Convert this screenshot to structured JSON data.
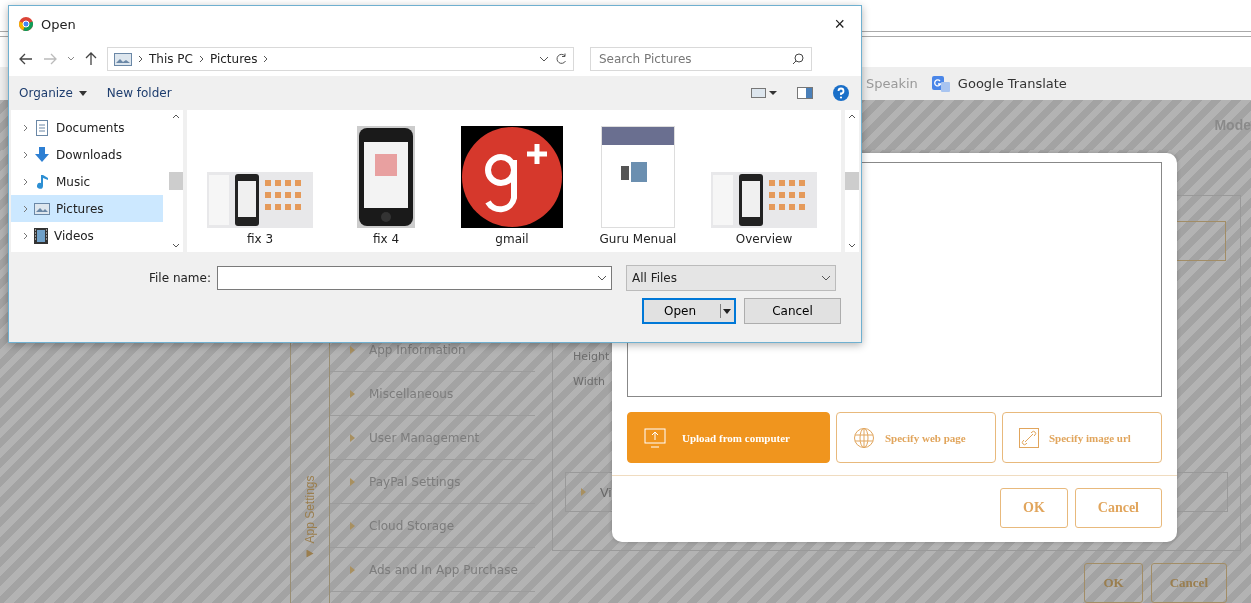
{
  "browser": {
    "bookmarks": [
      {
        "label": "Speakin",
        "kind": "plain"
      },
      {
        "label": "Google Translate",
        "kind": "translate"
      }
    ],
    "header_text": "Mode"
  },
  "app": {
    "side_label": "App Settings",
    "menu": [
      "App Information",
      "Miscellaneous",
      "User Management",
      "PayPal Settings",
      "Cloud Storage",
      "Ads and In App Purchase"
    ],
    "form_labels": [
      "Height",
      "Width"
    ],
    "section": "Vi",
    "buttons": [
      "OK",
      "Cancel"
    ]
  },
  "image_modal": {
    "sources": [
      {
        "label": "Upload from computer",
        "kind": "upload",
        "selected": true
      },
      {
        "label": "Specify web page",
        "kind": "web",
        "selected": false
      },
      {
        "label": "Specify image url",
        "kind": "link",
        "selected": false
      }
    ],
    "buttons": [
      "OK",
      "Cancel"
    ]
  },
  "open_dialog": {
    "title": "Open",
    "close": "×",
    "breadcrumb": [
      "This PC",
      "Pictures"
    ],
    "search": {
      "placeholder": "Search Pictures"
    },
    "toolbar": [
      "Organize",
      "New folder"
    ],
    "nav": [
      {
        "label": "Documents",
        "kind": "documents",
        "selected": false
      },
      {
        "label": "Downloads",
        "kind": "downloads",
        "selected": false
      },
      {
        "label": "Music",
        "kind": "music",
        "selected": false
      },
      {
        "label": "Pictures",
        "kind": "pictures",
        "selected": true
      },
      {
        "label": "Videos",
        "kind": "videos",
        "selected": false
      }
    ],
    "files": [
      {
        "name": "fix 3",
        "kind": "screens"
      },
      {
        "name": "fix 4",
        "kind": "phone"
      },
      {
        "name": "gmail",
        "kind": "gplus"
      },
      {
        "name": "Guru Menual",
        "kind": "document"
      },
      {
        "name": "Overview",
        "kind": "screens"
      }
    ],
    "file_name": {
      "label": "File name:"
    },
    "filter": "All Files",
    "buttons": [
      "Open",
      "Cancel"
    ]
  }
}
